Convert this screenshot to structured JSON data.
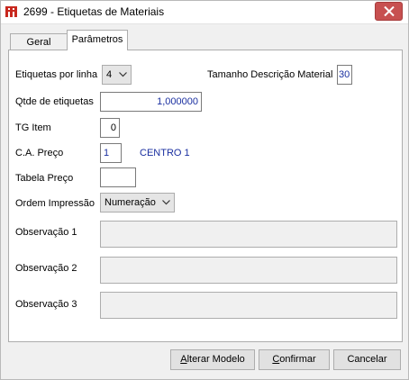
{
  "window": {
    "title": "2699 - Etiquetas de Materiais"
  },
  "tabs": [
    {
      "label": "Geral",
      "active": false
    },
    {
      "label": "Parâmetros",
      "active": true
    }
  ],
  "form": {
    "etiquetas_por_linha": {
      "label": "Etiquetas por linha",
      "value": "4"
    },
    "tamanho_descricao": {
      "label": "Tamanho Descrição Material",
      "value": "30"
    },
    "qtde_etiquetas": {
      "label": "Qtde de etiquetas",
      "value": "1,000000"
    },
    "tg_item": {
      "label": "TG Item",
      "value": "0"
    },
    "ca_preco": {
      "label": "C.A. Preço",
      "value": "1",
      "description": "CENTRO 1"
    },
    "tabela_preco": {
      "label": "Tabela Preço",
      "value": ""
    },
    "ordem_impressao": {
      "label": "Ordem Impressão",
      "value": "Numeração"
    },
    "observacao1": {
      "label": "Observação 1",
      "value": ""
    },
    "observacao2": {
      "label": "Observação 2",
      "value": ""
    },
    "observacao3": {
      "label": "Observação 3",
      "value": ""
    }
  },
  "buttons": {
    "alterar_modelo": {
      "first": "A",
      "rest": "lterar Modelo"
    },
    "confirmar": {
      "first": "C",
      "rest": "onfirmar"
    },
    "cancelar": {
      "label": "Cancelar"
    }
  },
  "icons": {
    "app": "app-logo-icon",
    "close": "close-icon",
    "dropdown": "chevron-down-icon"
  },
  "colors": {
    "close_button": "#c75050",
    "value_text_blue": "#1a2fa0",
    "app_icon_red": "#c8281e"
  }
}
